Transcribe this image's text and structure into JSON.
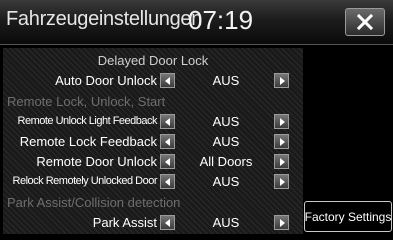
{
  "header": {
    "title": "Fahrzeugeinstellungen",
    "time": "07:19",
    "close_icon": "close-icon"
  },
  "settings": {
    "sub_header": "Delayed Door Lock",
    "rows": [
      {
        "label": "Auto Door Unlock",
        "value": "AUS"
      },
      {
        "label": "Remote Lock, Unlock, Start"
      },
      {
        "label": "Remote Unlock Light Feedback",
        "value": "AUS"
      },
      {
        "label": "Remote Lock Feedback",
        "value": "AUS"
      },
      {
        "label": "Remote Door Unlock",
        "value": "All Doors"
      },
      {
        "label": "Relock Remotely Unlocked Door",
        "value": "AUS"
      },
      {
        "label": "Park Assist/Collision detection"
      },
      {
        "label": "Park Assist",
        "value": "AUS"
      }
    ]
  },
  "actions": {
    "factory_settings": "Factory Settings"
  }
}
